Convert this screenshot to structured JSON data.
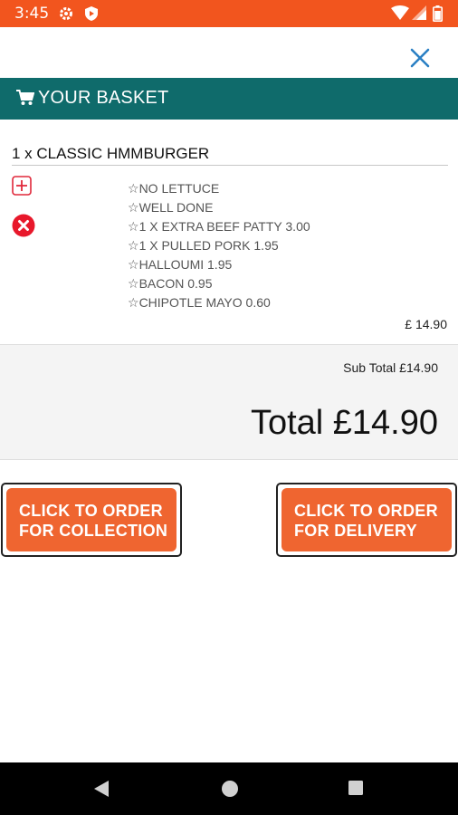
{
  "status_bar": {
    "time": "3:45",
    "icons": [
      "settings-icon",
      "shield-play-icon",
      "wifi-icon",
      "signal-icon",
      "battery-icon"
    ],
    "color": "#f2551e"
  },
  "header": {
    "close_icon": "close-icon",
    "basket_title": "YOUR BASKET",
    "color": "#0f6b6b"
  },
  "item": {
    "title": "1 x CLASSIC HMMBURGER",
    "options": [
      "NO LETTUCE",
      "WELL DONE",
      "1 X EXTRA BEEF PATTY 3.00",
      "1 X PULLED PORK 1.95",
      "HALLOUMI 1.95",
      "BACON 0.95",
      "CHIPOTLE MAYO 0.60"
    ],
    "price": "£ 14.90"
  },
  "totals": {
    "subtotal": "Sub Total £14.90",
    "total": "Total £14.90"
  },
  "buttons": {
    "collection_line1": "CLICK TO ORDER",
    "collection_line2": "FOR COLLECTION",
    "delivery_line1": "CLICK TO ORDER",
    "delivery_line2": "FOR DELIVERY",
    "color": "#ef6530"
  },
  "nav": {
    "icons": [
      "back-icon",
      "home-icon",
      "recents-icon"
    ]
  }
}
